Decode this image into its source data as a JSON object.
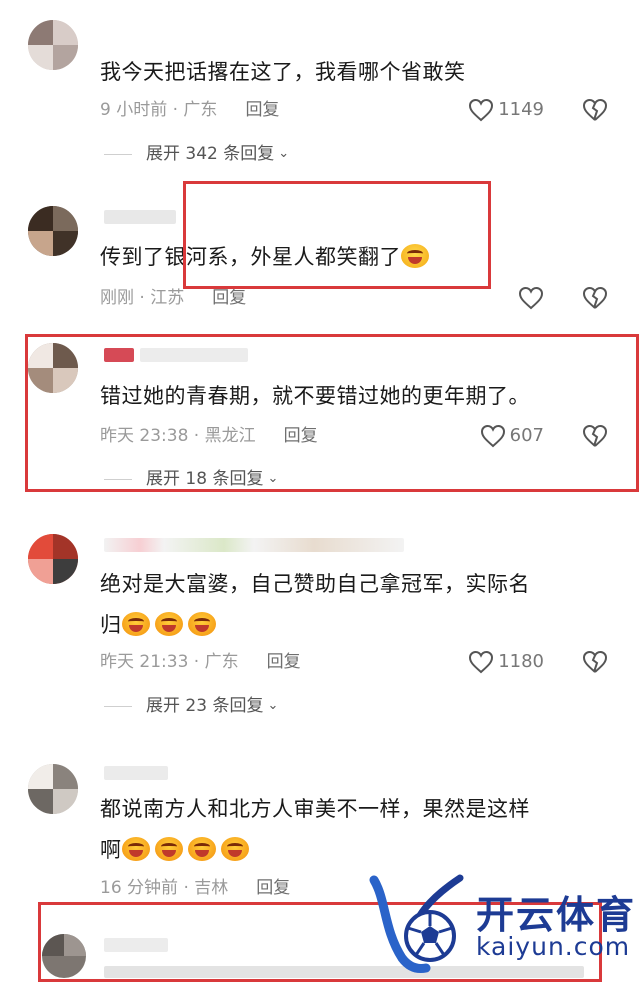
{
  "comments": [
    {
      "text": "我今天把话撂在这了，我看哪个省敢笑",
      "time": "9 小时前 · 广东",
      "reply": "回复",
      "likes": "1149",
      "expand": "展开 342 条回复"
    },
    {
      "text": "传到了银河系，外星人都笑翻了",
      "time": "刚刚 · 江苏",
      "reply": "回复",
      "likes": "",
      "expand": ""
    },
    {
      "text": "错过她的青春期，就不要错过她的更年期了。",
      "time": "昨天 23:38 · 黑龙江",
      "reply": "回复",
      "likes": "607",
      "expand": "展开 18 条回复"
    },
    {
      "text_line1": "绝对是大富婆，自己赞助自己拿冠军，实际名",
      "text_line2": "归",
      "time": "昨天 21:33 · 广东",
      "reply": "回复",
      "likes": "1180",
      "expand": "展开 23 条回复"
    },
    {
      "text_line1": "都说南方人和北方人审美不一样，果然是这样",
      "text_line2": "啊",
      "time": "16 分钟前 · 吉林",
      "reply": "回复"
    }
  ],
  "watermark": {
    "cn": "开云体育",
    "en": "kaiyun.com"
  },
  "colors": {
    "highlight": "#d9393b",
    "brand": "#1d3b94",
    "meta": "#9a9a9a"
  },
  "icons": [
    "heart-outline-icon",
    "broken-heart-icon",
    "chevron-down-icon",
    "grin-emoji-icon",
    "laughing-crying-emoji-icon"
  ]
}
